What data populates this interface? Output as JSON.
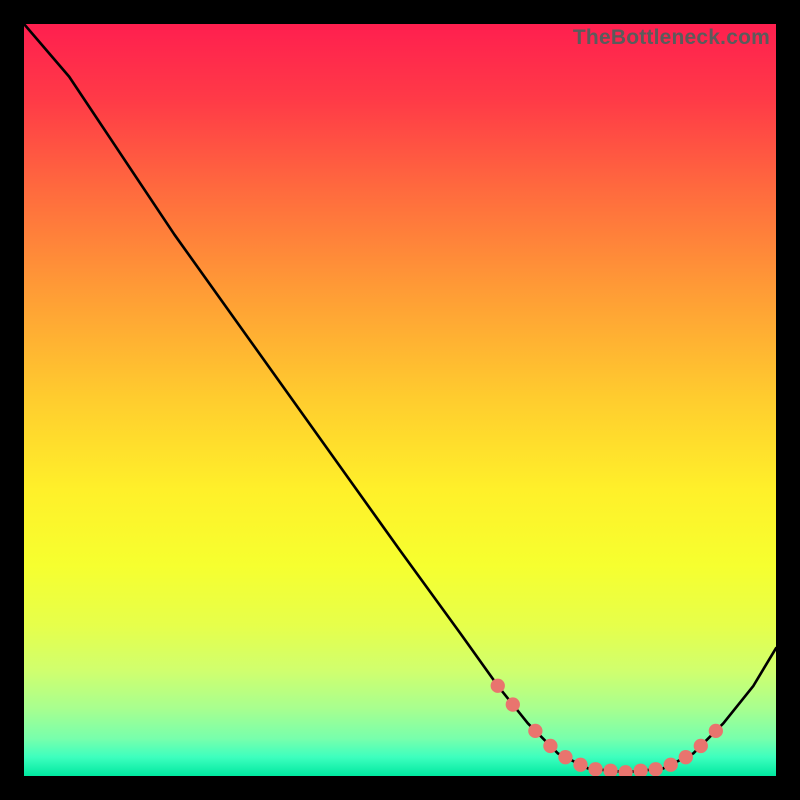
{
  "watermark": "TheBottleneck.com",
  "chart_data": {
    "type": "line",
    "title": "",
    "xlabel": "",
    "ylabel": "",
    "xlim": [
      0,
      100
    ],
    "ylim": [
      0,
      100
    ],
    "grid": false,
    "legend": false,
    "curve_points": [
      {
        "x": 0,
        "y": 100
      },
      {
        "x": 6,
        "y": 93
      },
      {
        "x": 12,
        "y": 84
      },
      {
        "x": 20,
        "y": 72
      },
      {
        "x": 30,
        "y": 58
      },
      {
        "x": 40,
        "y": 44
      },
      {
        "x": 50,
        "y": 30
      },
      {
        "x": 58,
        "y": 19
      },
      {
        "x": 63,
        "y": 12
      },
      {
        "x": 67,
        "y": 7
      },
      {
        "x": 71,
        "y": 3
      },
      {
        "x": 75,
        "y": 1
      },
      {
        "x": 80,
        "y": 0.5
      },
      {
        "x": 85,
        "y": 1
      },
      {
        "x": 89,
        "y": 3
      },
      {
        "x": 93,
        "y": 7
      },
      {
        "x": 97,
        "y": 12
      },
      {
        "x": 100,
        "y": 17
      }
    ],
    "marker_points_x": [
      63,
      65,
      68,
      70,
      72,
      74,
      76,
      78,
      80,
      82,
      84,
      86,
      88,
      90,
      92
    ],
    "curve_color": "#000000",
    "marker_color": "#e9746e",
    "background_gradient_stops": [
      {
        "offset": 0.0,
        "color": "#ff1f4f"
      },
      {
        "offset": 0.1,
        "color": "#ff3a47"
      },
      {
        "offset": 0.22,
        "color": "#ff6a3e"
      },
      {
        "offset": 0.35,
        "color": "#ff9a36"
      },
      {
        "offset": 0.5,
        "color": "#ffcd2e"
      },
      {
        "offset": 0.62,
        "color": "#fff02a"
      },
      {
        "offset": 0.72,
        "color": "#f6ff2f"
      },
      {
        "offset": 0.8,
        "color": "#e6ff4b"
      },
      {
        "offset": 0.86,
        "color": "#d0ff6e"
      },
      {
        "offset": 0.91,
        "color": "#a8ff8f"
      },
      {
        "offset": 0.95,
        "color": "#78ffac"
      },
      {
        "offset": 0.975,
        "color": "#3dffbe"
      },
      {
        "offset": 1.0,
        "color": "#00e8a0"
      }
    ]
  }
}
